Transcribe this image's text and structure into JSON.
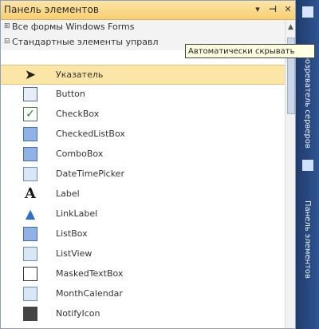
{
  "toolbox": {
    "title": "Панель элементов",
    "groups": [
      {
        "label": "Все формы Windows Forms",
        "expanded": false
      },
      {
        "label": "Стандартные элементы управл",
        "expanded": true
      }
    ],
    "items": [
      {
        "label": "Указатель",
        "icon": "pointer-icon",
        "selected": true
      },
      {
        "label": "Button",
        "icon": "button-icon"
      },
      {
        "label": "CheckBox",
        "icon": "checkbox-icon"
      },
      {
        "label": "CheckedListBox",
        "icon": "checkedlistbox-icon"
      },
      {
        "label": "ComboBox",
        "icon": "combobox-icon"
      },
      {
        "label": "DateTimePicker",
        "icon": "datetimepicker-icon"
      },
      {
        "label": "Label",
        "icon": "label-icon"
      },
      {
        "label": "LinkLabel",
        "icon": "linklabel-icon"
      },
      {
        "label": "ListBox",
        "icon": "listbox-icon"
      },
      {
        "label": "ListView",
        "icon": "listview-icon"
      },
      {
        "label": "MaskedTextBox",
        "icon": "maskedtextbox-icon"
      },
      {
        "label": "MonthCalendar",
        "icon": "monthcalendar-icon"
      },
      {
        "label": "NotifyIcon",
        "icon": "notifyicon-icon"
      }
    ]
  },
  "tooltip": "Автоматически скрывать",
  "right_strip": {
    "tab1": "Обозреватель серверов",
    "tab2": "Панель элементов"
  },
  "colors": {
    "title_bar": "#f7cf73",
    "selected_item": "#fbe6a8",
    "strip_bg": "#2f5593"
  }
}
